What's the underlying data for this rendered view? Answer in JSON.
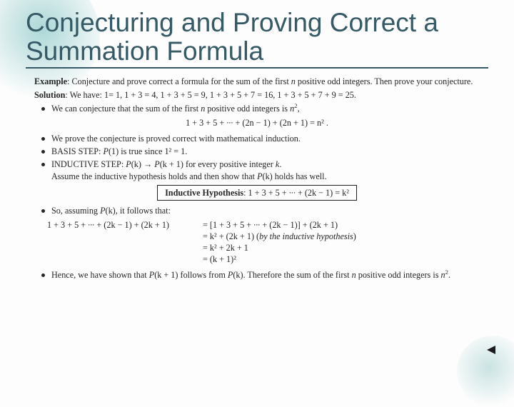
{
  "title": "Conjecturing and Proving Correct a Summation Formula",
  "lead": {
    "example_label": "Example",
    "example_text": ": Conjecture and prove correct a formula for the sum of the first ",
    "example_n": "n",
    "example_text2": " positive odd integers. Then prove your conjecture.",
    "solution_label": "Solution",
    "solution_text": ": We have:   1= 1, 1 + 3 = 4, 1 + 3 + 5 = 9, 1 + 3 + 5 + 7 = 16, 1 + 3 + 5 + 7 + 9 = 25."
  },
  "bullets1": {
    "conj_a": "We can conjecture that the sum of the first ",
    "conj_n": "n",
    "conj_b": " positive odd integers is ",
    "conj_c": "n",
    "conj_d": ","
  },
  "eq1": "1 + 3 + 5 + ∙∙∙ + (2n − 1) + (2n + 1) = n² .",
  "bullets2": {
    "b1": "We prove the conjecture is proved correct with mathematical induction.",
    "b2a": "BASIS STEP: ",
    "b2b": "P",
    "b2c": "(1) is true since 1² = 1.",
    "b3a": "INDUCTIVE STEP: ",
    "b3b": "P",
    "b3c": "(k) → ",
    "b3d": "P",
    "b3e": "(k + 1) for every positive integer ",
    "b3f": "k",
    "b3g": ".",
    "assume_a": "Assume the inductive hypothesis holds and then show that ",
    "assume_b": "P",
    "assume_c": "(k) holds has well."
  },
  "hyp": {
    "label": "Inductive Hypothesis",
    "eq": ": 1 + 3 + 5 + ∙∙∙ + (2k − 1)  = k²"
  },
  "so_assume_a": "So, assuming ",
  "so_assume_b": "P",
  "so_assume_c": "(k), it follows that:",
  "align": {
    "l1_left": "1 + 3 + 5 + ∙∙∙ + (2k − 1) + (2k + 1) ",
    "l1_right": "= [1 + 3 + 5 + ∙∙∙ + (2k − 1)] + (2k + 1)",
    "l2_right_a": "= k² + (2k + 1)  (",
    "l2_right_b": "by the inductive hypothesis",
    "l2_right_c": ")",
    "l3_right": "= k² + 2k + 1",
    "l4_right": "= (k + 1)²"
  },
  "final_a": "Hence, we have shown that ",
  "final_b": "P",
  "final_c": "(k + 1) follows from ",
  "final_d": "P",
  "final_e": "(k). Therefore the sum of the first ",
  "final_f": "n",
  "final_g": " positive odd integers is ",
  "final_h": "n",
  "final_i": "."
}
